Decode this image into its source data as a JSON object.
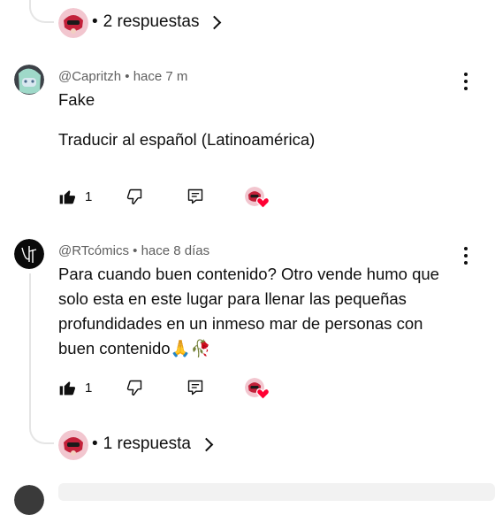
{
  "top_thread": {
    "replies_label": "2 respuestas"
  },
  "comments": [
    {
      "author": "@Capritzh",
      "time": "hace 7 m",
      "text": "Fake",
      "translate_label": "Traducir al español (Latinoamérica)",
      "likes": "1"
    },
    {
      "author": "@RTcómics",
      "time": "hace 8 días",
      "text_lines": [
        "Para cuando buen contenido? Otro vende humo que",
        "solo esta en este lugar para llenar las pequeñas",
        "profundidades en un inmeso mar de personas con",
        "buen contenido🙏🥀"
      ],
      "likes": "1",
      "replies_label": "1 respuesta"
    }
  ],
  "separator": "•",
  "colors": {
    "text": "#0f0f0f",
    "meta": "#606060",
    "heart": "#ff0033",
    "thread_line": "#e5e5e5"
  },
  "icons": {
    "like": "thumb-up-icon",
    "dislike": "thumb-down-icon",
    "reply": "reply-comment-icon",
    "more": "more-vert-icon",
    "creator_heart": "creator-heart-icon"
  }
}
